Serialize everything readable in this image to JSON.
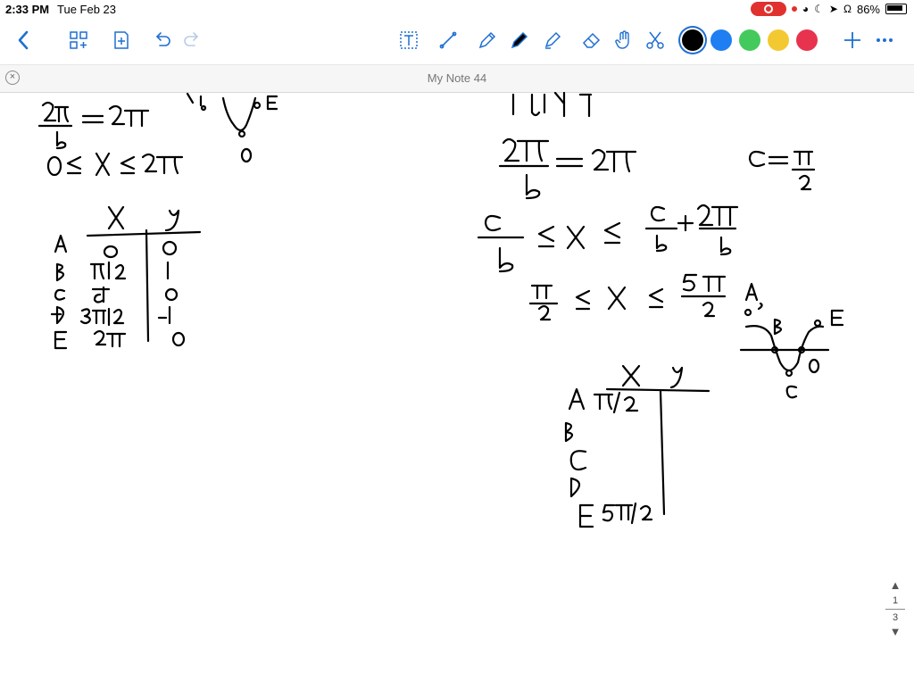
{
  "status_bar": {
    "time": "2:33 PM",
    "date": "Tue Feb 23",
    "battery": "86%"
  },
  "toolbar": {
    "back_icon": "chevron-left-icon",
    "grid_icon": "grid-add-icon",
    "add_page_icon": "add-page-icon",
    "undo_icon": "undo-icon",
    "redo_icon": "redo-icon",
    "text_tool_icon": "text-tool-icon",
    "line_tool_icon": "line-tool-icon",
    "pen_tool_icon": "pen-icon",
    "highlighter_icon": "highlighter-icon",
    "marker_icon": "marker-icon",
    "eraser_icon": "eraser-icon",
    "hand_tool_icon": "hand-icon",
    "scissors_icon": "scissors-icon",
    "colors": [
      "#000000",
      "#1e7ef2",
      "#44c95d",
      "#f3c932",
      "#e8334f"
    ],
    "add_icon": "plus-icon",
    "more_icon": "more-icon"
  },
  "note": {
    "title": "My Note 44",
    "close_icon": "close-icon"
  },
  "pager": {
    "current": "1",
    "total": "3"
  }
}
